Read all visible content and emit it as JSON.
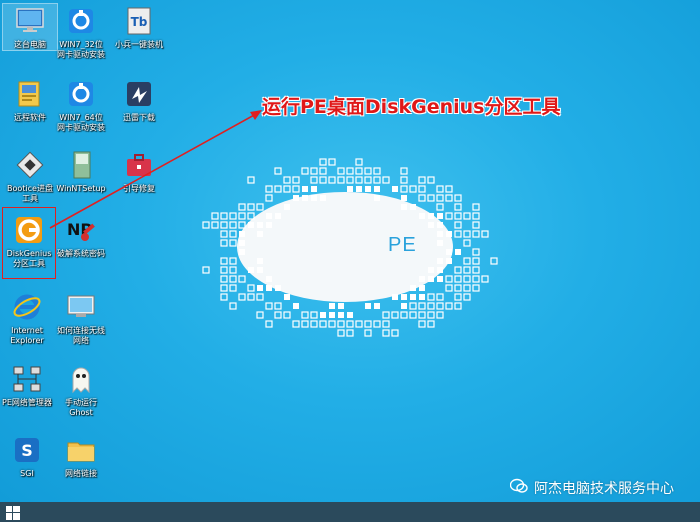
{
  "desktop_icons": [
    {
      "name": "computer",
      "label_lines": [
        "这台电脑"
      ]
    },
    {
      "name": "win7-32-driver",
      "label_lines": [
        "WIN7_32位",
        "网卡驱动安装"
      ]
    },
    {
      "name": "onekey-install",
      "label_lines": [
        "小兵一键装机"
      ]
    },
    {
      "name": "remote-software",
      "label_lines": [
        "远程软件"
      ]
    },
    {
      "name": "win7-64-driver",
      "label_lines": [
        "WIN7_64位",
        "网卡驱动安装"
      ]
    },
    {
      "name": "xunlei",
      "label_lines": [
        "迅雷下载"
      ]
    },
    {
      "name": "bootice",
      "label_lines": [
        "Bootice进盘",
        "工具"
      ]
    },
    {
      "name": "winntsetup",
      "label_lines": [
        "WinNTSetup"
      ]
    },
    {
      "name": "boot-repair",
      "label_lines": [
        "引导修复"
      ]
    },
    {
      "name": "diskgenius",
      "label_lines": [
        "DiskGenius",
        "分区工具"
      ]
    },
    {
      "name": "crack-password",
      "label_lines": [
        "破解系统密码"
      ]
    },
    {
      "name": "internet-explorer",
      "label_lines": [
        "Internet",
        "Explorer"
      ]
    },
    {
      "name": "wireless",
      "label_lines": [
        "如何连接无线",
        "网络"
      ]
    },
    {
      "name": "pe-network",
      "label_lines": [
        "PE网络管理器"
      ]
    },
    {
      "name": "ghost",
      "label_lines": [
        "手动运行",
        "Ghost"
      ]
    },
    {
      "name": "sgi",
      "label_lines": [
        "SGI"
      ]
    },
    {
      "name": "network-link",
      "label_lines": [
        "网络链接"
      ]
    }
  ],
  "annotation": {
    "text": "运行PE桌面DiskGenius分区工具",
    "color": "#e01818"
  },
  "logo": {
    "text": "PE"
  },
  "watermark": {
    "text": "阿杰电脑技术服务中心"
  },
  "colors": {
    "desktop": "#22aee6",
    "taskbar": "#2b4a5c",
    "highlight": "#e02020"
  }
}
